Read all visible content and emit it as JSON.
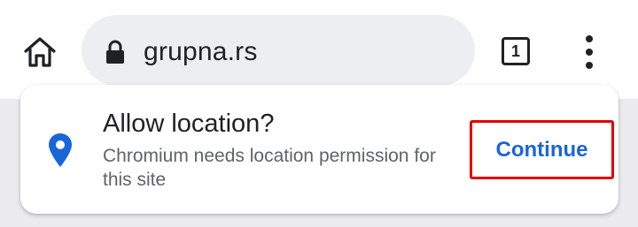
{
  "toolbar": {
    "url": "grupna.rs",
    "tab_count": "1"
  },
  "icons": {
    "home": "home-icon",
    "lock": "lock-icon",
    "menu": "more-vert-icon",
    "location": "location-pin-icon"
  },
  "colors": {
    "accent": "#1a66d8",
    "highlight_border": "#e00000",
    "omnibox_bg": "#eceef2"
  },
  "permission_prompt": {
    "title": "Allow location?",
    "message": "Chromium needs location permission for this site",
    "continue_label": "Continue"
  }
}
